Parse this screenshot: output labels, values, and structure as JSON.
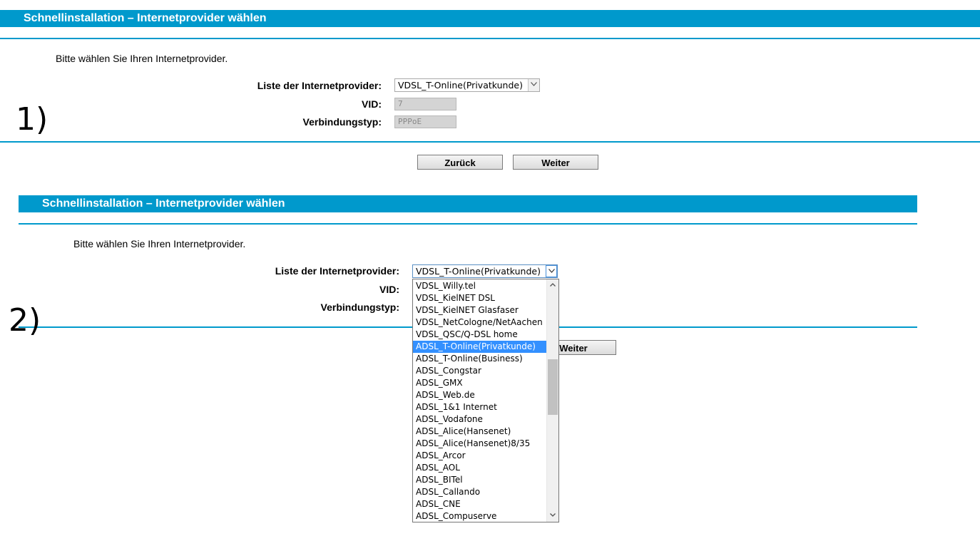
{
  "panel1": {
    "title": "Schnellinstallation – Internetprovider wählen",
    "intro": "Bitte wählen Sie Ihren Internetprovider.",
    "provider_label": "Liste der Internetprovider:",
    "provider_value": "VDSL_T-Online(Privatkunde)",
    "vid_label": "VID:",
    "vid_value": "7",
    "conn_label": "Verbindungstyp:",
    "conn_value": "PPPoE",
    "back_label": "Zurück",
    "next_label": "Weiter",
    "marker": "1)"
  },
  "panel2": {
    "title": "Schnellinstallation – Internetprovider wählen",
    "intro": "Bitte wählen Sie Ihren Internetprovider.",
    "provider_label": "Liste der Internetprovider:",
    "provider_value": "VDSL_T-Online(Privatkunde)",
    "vid_label": "VID:",
    "conn_label": "Verbindungstyp:",
    "next_label": "Weiter",
    "marker": "2)",
    "dropdown_options": [
      "VDSL_Willy.tel",
      "VDSL_KielNET DSL",
      "VDSL_KielNET Glasfaser",
      "VDSL_NetCologne/NetAachen",
      "VDSL_QSC/Q-DSL home",
      "ADSL_T-Online(Privatkunde)",
      "ADSL_T-Online(Business)",
      "ADSL_Congstar",
      "ADSL_GMX",
      "ADSL_Web.de",
      "ADSL_1&1 Internet",
      "ADSL_Vodafone",
      "ADSL_Alice(Hansenet)",
      "ADSL_Alice(Hansenet)8/35",
      "ADSL_Arcor",
      "ADSL_AOL",
      "ADSL_BITel",
      "ADSL_Callando",
      "ADSL_CNE",
      "ADSL_Compuserve"
    ],
    "highlighted_option": "ADSL_T-Online(Privatkunde)"
  },
  "colors": {
    "accent": "#0099cc",
    "highlight": "#3390ff"
  }
}
